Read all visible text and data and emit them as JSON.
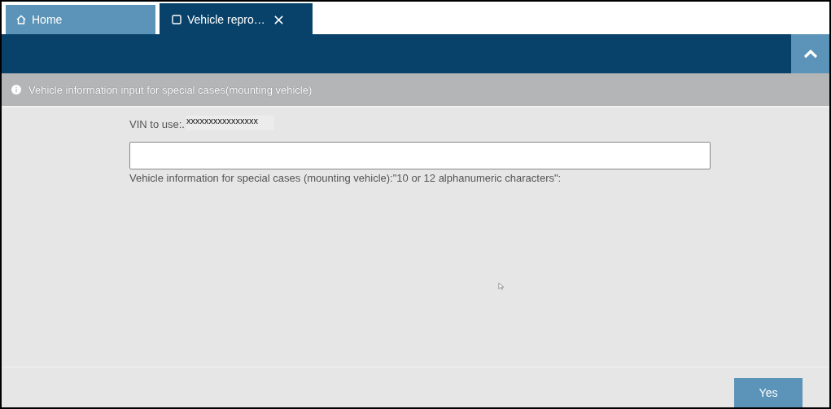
{
  "tabs": [
    {
      "label": "Home",
      "kind": "home",
      "selected": false
    },
    {
      "label": "Vehicle repro…",
      "kind": "page",
      "selected": true
    }
  ],
  "info_bar": {
    "message": "Vehicle information input for special cases(mounting vehicle)"
  },
  "form": {
    "vin_label": "VIN to use:.",
    "vin_value": "xxxxxxxxxxxxxxxx",
    "input_label": "Vehicle information for special cases (mounting vehicle):\"10 or 12 alphanumeric characters\":"
  },
  "buttons": [
    {
      "label": "Yes"
    }
  ]
}
